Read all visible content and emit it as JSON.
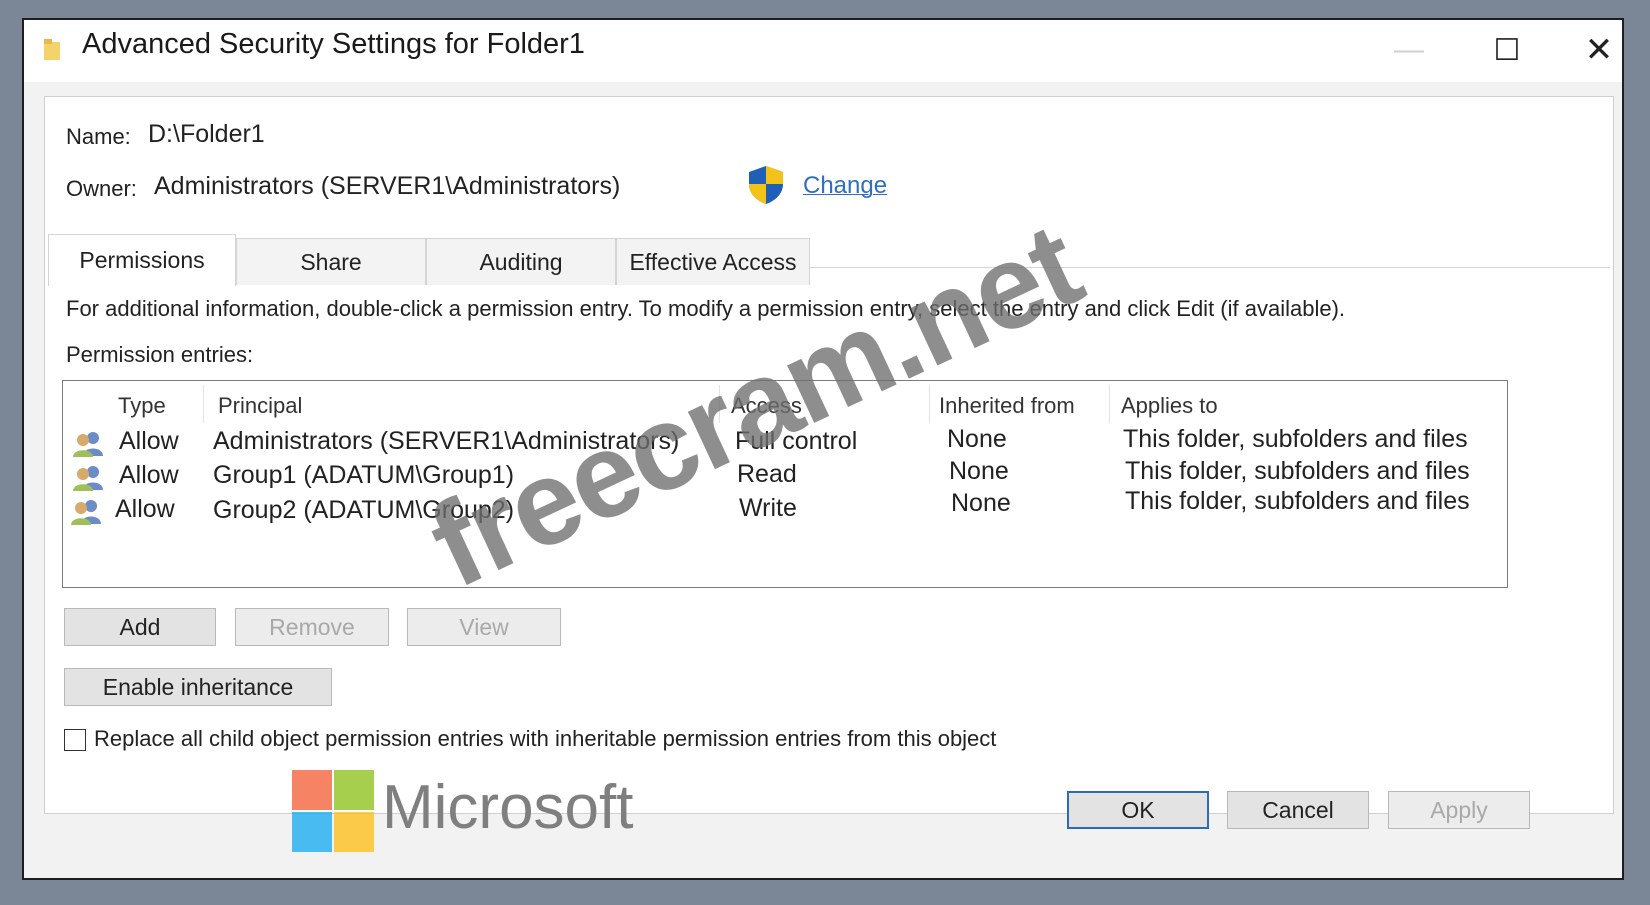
{
  "window": {
    "title": "Advanced Security Settings for Folder1",
    "controls": {
      "minimize": "—",
      "maximize": "☐",
      "close": "✕"
    }
  },
  "object": {
    "name_label": "Name:",
    "name_value": "D:\\Folder1",
    "owner_label": "Owner:",
    "owner_value": "Administrators (SERVER1\\Administrators)",
    "change_link": "Change"
  },
  "tabs": [
    {
      "label": "Permissions",
      "active": true
    },
    {
      "label": "Share",
      "active": false
    },
    {
      "label": "Auditing",
      "active": false
    },
    {
      "label": "Effective Access",
      "active": false
    }
  ],
  "info_text": "For additional information, double-click a permission entry. To modify a permission entry, select the entry and click Edit (if available).",
  "entries_label": "Permission entries:",
  "columns": [
    "Type",
    "Principal",
    "Access",
    "Inherited from",
    "Applies to"
  ],
  "entries": [
    {
      "type": "Allow",
      "principal": "Administrators (SERVER1\\Administrators)",
      "access": "Full control",
      "inherited_from": "None",
      "applies_to": "This folder, subfolders and files"
    },
    {
      "type": "Allow",
      "principal": "Group1 (ADATUM\\Group1)",
      "access": "Read",
      "inherited_from": "None",
      "applies_to": "This folder, subfolders and files"
    },
    {
      "type": "Allow",
      "principal": "Group2 (ADATUM\\Group2)",
      "access": "Write",
      "inherited_from": "None",
      "applies_to": "This folder, subfolders and files"
    }
  ],
  "buttons": {
    "add": "Add",
    "remove": "Remove",
    "view": "View",
    "enable_inheritance": "Enable inheritance",
    "ok": "OK",
    "cancel": "Cancel",
    "apply": "Apply"
  },
  "replace_checkbox": {
    "label": "Replace all child object permission entries with inheritable permission entries from this object",
    "checked": false
  },
  "branding": {
    "watermark": "freecram.net",
    "logo_text": "Microsoft",
    "logo_colors": [
      "#f25022",
      "#7fba00",
      "#00a4ef",
      "#ffb900"
    ]
  },
  "icons": {
    "title": "folder-icon",
    "owner_change": "uac-shield-icon",
    "entry": "user-group-icon"
  }
}
